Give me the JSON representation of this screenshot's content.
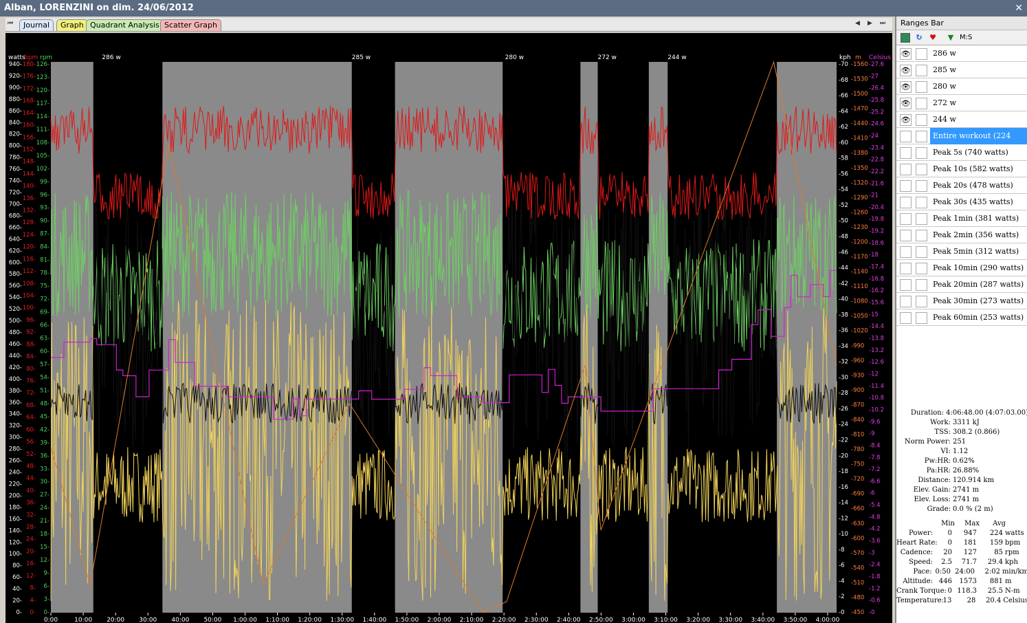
{
  "window": {
    "title": "Alban, LORENZINI on dim. 24/06/2012",
    "close_glyph": "✕"
  },
  "tabs": [
    {
      "label": "Journal",
      "color": "#dde8f8"
    },
    {
      "label": "Graph",
      "color": "#f3ef7a"
    },
    {
      "label": "Quadrant Analysis",
      "color": "#c9ecb3"
    },
    {
      "label": "Scatter Graph",
      "color": "#f4b7b7"
    }
  ],
  "nav": {
    "first": "⏮",
    "prev": "◀",
    "next": "▶",
    "last": "⏭"
  },
  "chart": {
    "axis_units": {
      "watts": "watts",
      "bpm": "bpm",
      "rpm": "rpm",
      "kph": "kph",
      "m": "m",
      "celsius": "Celsius"
    },
    "watts_ticks": [
      "940-",
      "920-",
      "900-",
      "880-",
      "860-",
      "840-",
      "820-",
      "800-",
      "780-",
      "760-",
      "740-",
      "720-",
      "700-",
      "680-",
      "660-",
      "640-",
      "620-",
      "600-",
      "580-",
      "560-",
      "540-",
      "520-",
      "500-",
      "480-",
      "460-",
      "440-",
      "420-",
      "400-",
      "380-",
      "360-",
      "340-",
      "320-",
      "300-",
      "280-",
      "260-",
      "240-",
      "220-",
      "200-",
      "180-",
      "160-",
      "140-",
      "120-",
      "100-",
      "80-",
      "60-",
      "40-",
      "20-",
      "0-"
    ],
    "bpm_ticks": [
      "180-",
      "176-",
      "172-",
      "168-",
      "164-",
      "160-",
      "156-",
      "152-",
      "148-",
      "144-",
      "140-",
      "136-",
      "132-",
      "128-",
      "124-",
      "120-",
      "116-",
      "112-",
      "108-",
      "104-",
      "100-",
      "96-",
      "92-",
      "88-",
      "84-",
      "80-",
      "76-",
      "72-",
      "68-",
      "64-",
      "60-",
      "56-",
      "52-",
      "48-",
      "44-",
      "40-",
      "36-",
      "32-",
      "28-",
      "24-",
      "20-",
      "16-",
      "12-",
      "8-",
      "4-",
      "0-"
    ],
    "rpm_ticks": [
      "126-",
      "123-",
      "120-",
      "117-",
      "114-",
      "111-",
      "108-",
      "105-",
      "102-",
      "99-",
      "96-",
      "93-",
      "90-",
      "87-",
      "84-",
      "81-",
      "78-",
      "75-",
      "72-",
      "69-",
      "66-",
      "63-",
      "60-",
      "57-",
      "54-",
      "51-",
      "48-",
      "45-",
      "42-",
      "39-",
      "36-",
      "33-",
      "30-",
      "27-",
      "24-",
      "21-",
      "18-",
      "15-",
      "12-",
      "9-",
      "6-",
      "3-",
      "0-"
    ],
    "kph_ticks": [
      "-70",
      "-68",
      "-66",
      "-64",
      "-62",
      "-60",
      "-58",
      "-56",
      "-54",
      "-52",
      "-50",
      "-48",
      "-46",
      "-44",
      "-42",
      "-40",
      "-38",
      "-36",
      "-34",
      "-32",
      "-30",
      "-28",
      "-26",
      "-24",
      "-22",
      "-20",
      "-18",
      "-16",
      "-14",
      "-12",
      "-10",
      "-8",
      "-6",
      "-4",
      "-2",
      "-0"
    ],
    "m_ticks": [
      "-1560",
      "-1530",
      "-1500",
      "-1470",
      "-1440",
      "-1410",
      "-1380",
      "-1350",
      "-1320",
      "-1290",
      "-1260",
      "-1230",
      "-1200",
      "-1170",
      "-1140",
      "-1110",
      "-1080",
      "-1050",
      "-1020",
      "-990",
      "-960",
      "-930",
      "-900",
      "-870",
      "-840",
      "-810",
      "-780",
      "-750",
      "-720",
      "-690",
      "-660",
      "-630",
      "-600",
      "-570",
      "-540",
      "-510",
      "-480",
      "-450"
    ],
    "celsius_ticks": [
      "-27.6",
      "-27",
      "-26.4",
      "-25.8",
      "-25.2",
      "-24.6",
      "-24",
      "-23.4",
      "-22.8",
      "-22.2",
      "-21.6",
      "-21",
      "-20.4",
      "-19.8",
      "-19.2",
      "-18.6",
      "-18",
      "-17.4",
      "-16.8",
      "-16.2",
      "-15.6",
      "-15",
      "-14.4",
      "-13.8",
      "-13.2",
      "-12.6",
      "-12",
      "-11.4",
      "-10.8",
      "-10.2",
      "-9.6",
      "-9",
      "-8.4",
      "-7.8",
      "-7.2",
      "-6.6",
      "-6",
      "-5.4",
      "-4.8",
      "-4.2",
      "-3.6",
      "-3",
      "-2.4",
      "-1.8",
      "-1.2",
      "-0.6",
      "-0"
    ],
    "time_ticks": [
      "0:00",
      "10:00",
      "20:00",
      "30:00",
      "40:00",
      "50:00",
      "1:00:00",
      "1:10:00",
      "1:20:00",
      "1:30:00",
      "1:40:00",
      "1:50:00",
      "2:00:00",
      "2:10:00",
      "2:20:00",
      "2:30:00",
      "2:40:00",
      "2:50:00",
      "3:00:00",
      "3:10:00",
      "3:20:00",
      "3:30:00",
      "3:40:00",
      "3:50:00",
      "4:00:00"
    ],
    "range_labels": [
      "286 w",
      "285 w",
      "280 w",
      "272 w",
      "244 w"
    ],
    "colors": {
      "power": "#f2d35a",
      "heart_rate": "#e01818",
      "cadence": "#6fcf64",
      "speed": "#101010",
      "altitude": "#e07a2a",
      "temperature": "#d020d0",
      "range_shade": "#8a8a8a",
      "watts_axis": "#ffffff",
      "bpm_axis": "#e02020",
      "rpm_axis": "#4fd05a",
      "m_axis": "#ff8040",
      "celsius_axis": "#e040e0"
    }
  },
  "ranges_bar": {
    "title": "Ranges Bar",
    "tool_label": "M:S",
    "rows": [
      {
        "eye": "👁",
        "label": "286 w",
        "selected": false
      },
      {
        "eye": "👁",
        "label": "285 w",
        "selected": false
      },
      {
        "eye": "👁",
        "label": "280 w",
        "selected": false
      },
      {
        "eye": "👁",
        "label": "272 w",
        "selected": false
      },
      {
        "eye": "👁",
        "label": "244 w",
        "selected": false
      },
      {
        "eye": "",
        "label": "Entire workout (224 watts)",
        "selected": true
      },
      {
        "eye": "",
        "label": "Peak 5s (740 watts)",
        "selected": false
      },
      {
        "eye": "",
        "label": "Peak 10s (582 watts)",
        "selected": false
      },
      {
        "eye": "",
        "label": "Peak 20s (478 watts)",
        "selected": false
      },
      {
        "eye": "",
        "label": "Peak 30s (435 watts)",
        "selected": false
      },
      {
        "eye": "",
        "label": "Peak 1min (381 watts)",
        "selected": false
      },
      {
        "eye": "",
        "label": "Peak 2min (356 watts)",
        "selected": false
      },
      {
        "eye": "",
        "label": "Peak 5min (312 watts)",
        "selected": false
      },
      {
        "eye": "",
        "label": "Peak 10min (290 watts)",
        "selected": false
      },
      {
        "eye": "",
        "label": "Peak 20min (287 watts)",
        "selected": false
      },
      {
        "eye": "",
        "label": "Peak 30min (273 watts)",
        "selected": false
      },
      {
        "eye": "",
        "label": "Peak 60min (253 watts)",
        "selected": false
      }
    ]
  },
  "summary": [
    {
      "k": "Duration:",
      "v": "4:06:48.00 (4:07:03.00)"
    },
    {
      "k": "Work:",
      "v": "3311 kJ"
    },
    {
      "k": "TSS:",
      "v": "308.2 (0.866)"
    },
    {
      "k": "Norm Power:",
      "v": "251"
    },
    {
      "k": "VI:",
      "v": "1.12"
    },
    {
      "k": "Pw:HR:",
      "v": "0.62%"
    },
    {
      "k": "Pa:HR:",
      "v": "26.88%"
    },
    {
      "k": "Distance:",
      "v": "120.914 km"
    },
    {
      "k": "Elev. Gain:",
      "v": "2741 m"
    },
    {
      "k": "Elev. Loss:",
      "v": "2741 m"
    },
    {
      "k": "Grade:",
      "v": "0.0 %  (2 m)"
    }
  ],
  "stats": {
    "header": {
      "min": "Min",
      "max": "Max",
      "avg": "Avg"
    },
    "rows": [
      {
        "k": "Power:",
        "min": "0",
        "max": "947",
        "avg": "224",
        "unit": "watts"
      },
      {
        "k": "Heart Rate:",
        "min": "0",
        "max": "181",
        "avg": "159",
        "unit": "bpm"
      },
      {
        "k": "Cadence:",
        "min": "20",
        "max": "127",
        "avg": "85",
        "unit": "rpm"
      },
      {
        "k": "Speed:",
        "min": "2.5",
        "max": "71.7",
        "avg": "29.4",
        "unit": "kph"
      },
      {
        "k": "Pace:",
        "min": "0:50",
        "max": "24:00",
        "avg": "2:02",
        "unit": "min/km"
      },
      {
        "k": "Altitude:",
        "min": "446",
        "max": "1573",
        "avg": "881",
        "unit": "m"
      },
      {
        "k": "Crank Torque:",
        "min": "0",
        "max": "118.3",
        "avg": "25.5",
        "unit": "N-m"
      },
      {
        "k": "Temperature:",
        "min": "13",
        "max": "28",
        "avg": "20.4",
        "unit": "Celsius"
      }
    ]
  }
}
